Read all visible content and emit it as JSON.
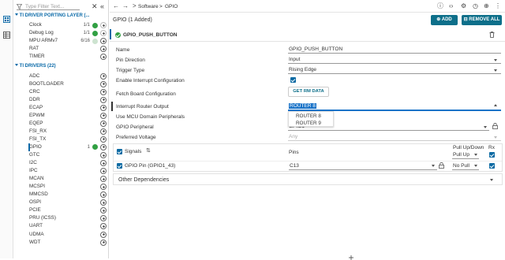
{
  "sidebar": {
    "filter_placeholder": "Type Filter Text...",
    "section_porting": "TI DRIVER PORTING LAYER (...",
    "porting_items": [
      {
        "label": "Clock",
        "count": "1/1"
      },
      {
        "label": "Debug Log",
        "count": "1/1"
      },
      {
        "label": "MPU ARMv7",
        "count": "6/16"
      },
      {
        "label": "RAT",
        "count": ""
      },
      {
        "label": "TIMER",
        "count": ""
      }
    ],
    "section_drivers": "TI DRIVERS (22)",
    "driver_items": [
      {
        "label": "ADC",
        "count": ""
      },
      {
        "label": "BOOTLOADER",
        "count": ""
      },
      {
        "label": "CRC",
        "count": ""
      },
      {
        "label": "DDR",
        "count": ""
      },
      {
        "label": "ECAP",
        "count": ""
      },
      {
        "label": "EPWM",
        "count": ""
      },
      {
        "label": "EQEP",
        "count": ""
      },
      {
        "label": "FSI_RX",
        "count": ""
      },
      {
        "label": "FSI_TX",
        "count": ""
      },
      {
        "label": "GPIO",
        "count": "1"
      },
      {
        "label": "GTC",
        "count": ""
      },
      {
        "label": "I2C",
        "count": ""
      },
      {
        "label": "IPC",
        "count": ""
      },
      {
        "label": "MCAN",
        "count": ""
      },
      {
        "label": "MCSPI",
        "count": ""
      },
      {
        "label": "MMCSD",
        "count": ""
      },
      {
        "label": "OSPI",
        "count": ""
      },
      {
        "label": "PCIE",
        "count": ""
      },
      {
        "label": "PRU (ICSS)",
        "count": ""
      },
      {
        "label": "UART",
        "count": ""
      },
      {
        "label": "UDMA",
        "count": ""
      },
      {
        "label": "WDT",
        "count": ""
      }
    ]
  },
  "breadcrumb": {
    "part1": "Software",
    "sep": ">",
    "part2": "GPIO"
  },
  "header": {
    "title": "GPIO (1 Added)",
    "add_label": "ADD",
    "remove_all_label": "REMOVE ALL"
  },
  "instance": {
    "name": "GPIO_PUSH_BUTTON"
  },
  "form": {
    "name_label": "Name",
    "name_value": "GPIO_PUSH_BUTTON",
    "pin_dir_label": "Pin Direction",
    "pin_dir_value": "Input",
    "trigger_label": "Trigger Type",
    "trigger_value": "Rising Edge",
    "interrupt_cfg_label": "Enable Interrupt Configuration",
    "fetch_label": "Fetch Board Configuration",
    "fetch_button": "GET RM DATA",
    "router_label": "Interrupt Router Output",
    "router_value": "ROUTER 8",
    "router_options": [
      "ROUTER 8",
      "ROUTER 9"
    ],
    "mcu_label": "Use MCU Domain Peripherals",
    "peripheral_label": "GPIO Peripheral",
    "peripheral_value": "GPIO1",
    "voltage_label": "Preferred Voltage",
    "voltage_value": "Any"
  },
  "signals": {
    "header_label": "Signals",
    "pins_header": "Pins",
    "pull_header": "Pull Up/Down",
    "rx_header": "Rx",
    "pull_header_value": "Pull Up",
    "row_label": "GPIO Pin (GPIO1_43)",
    "row_pin": "C13",
    "row_pull": "No Pull"
  },
  "other": {
    "label": "Other Dependencies"
  },
  "colors": {
    "accent": "#0d6f8a",
    "check": "#0b6aa3",
    "ok": "#31a043",
    "section": "#0a6aa8"
  }
}
